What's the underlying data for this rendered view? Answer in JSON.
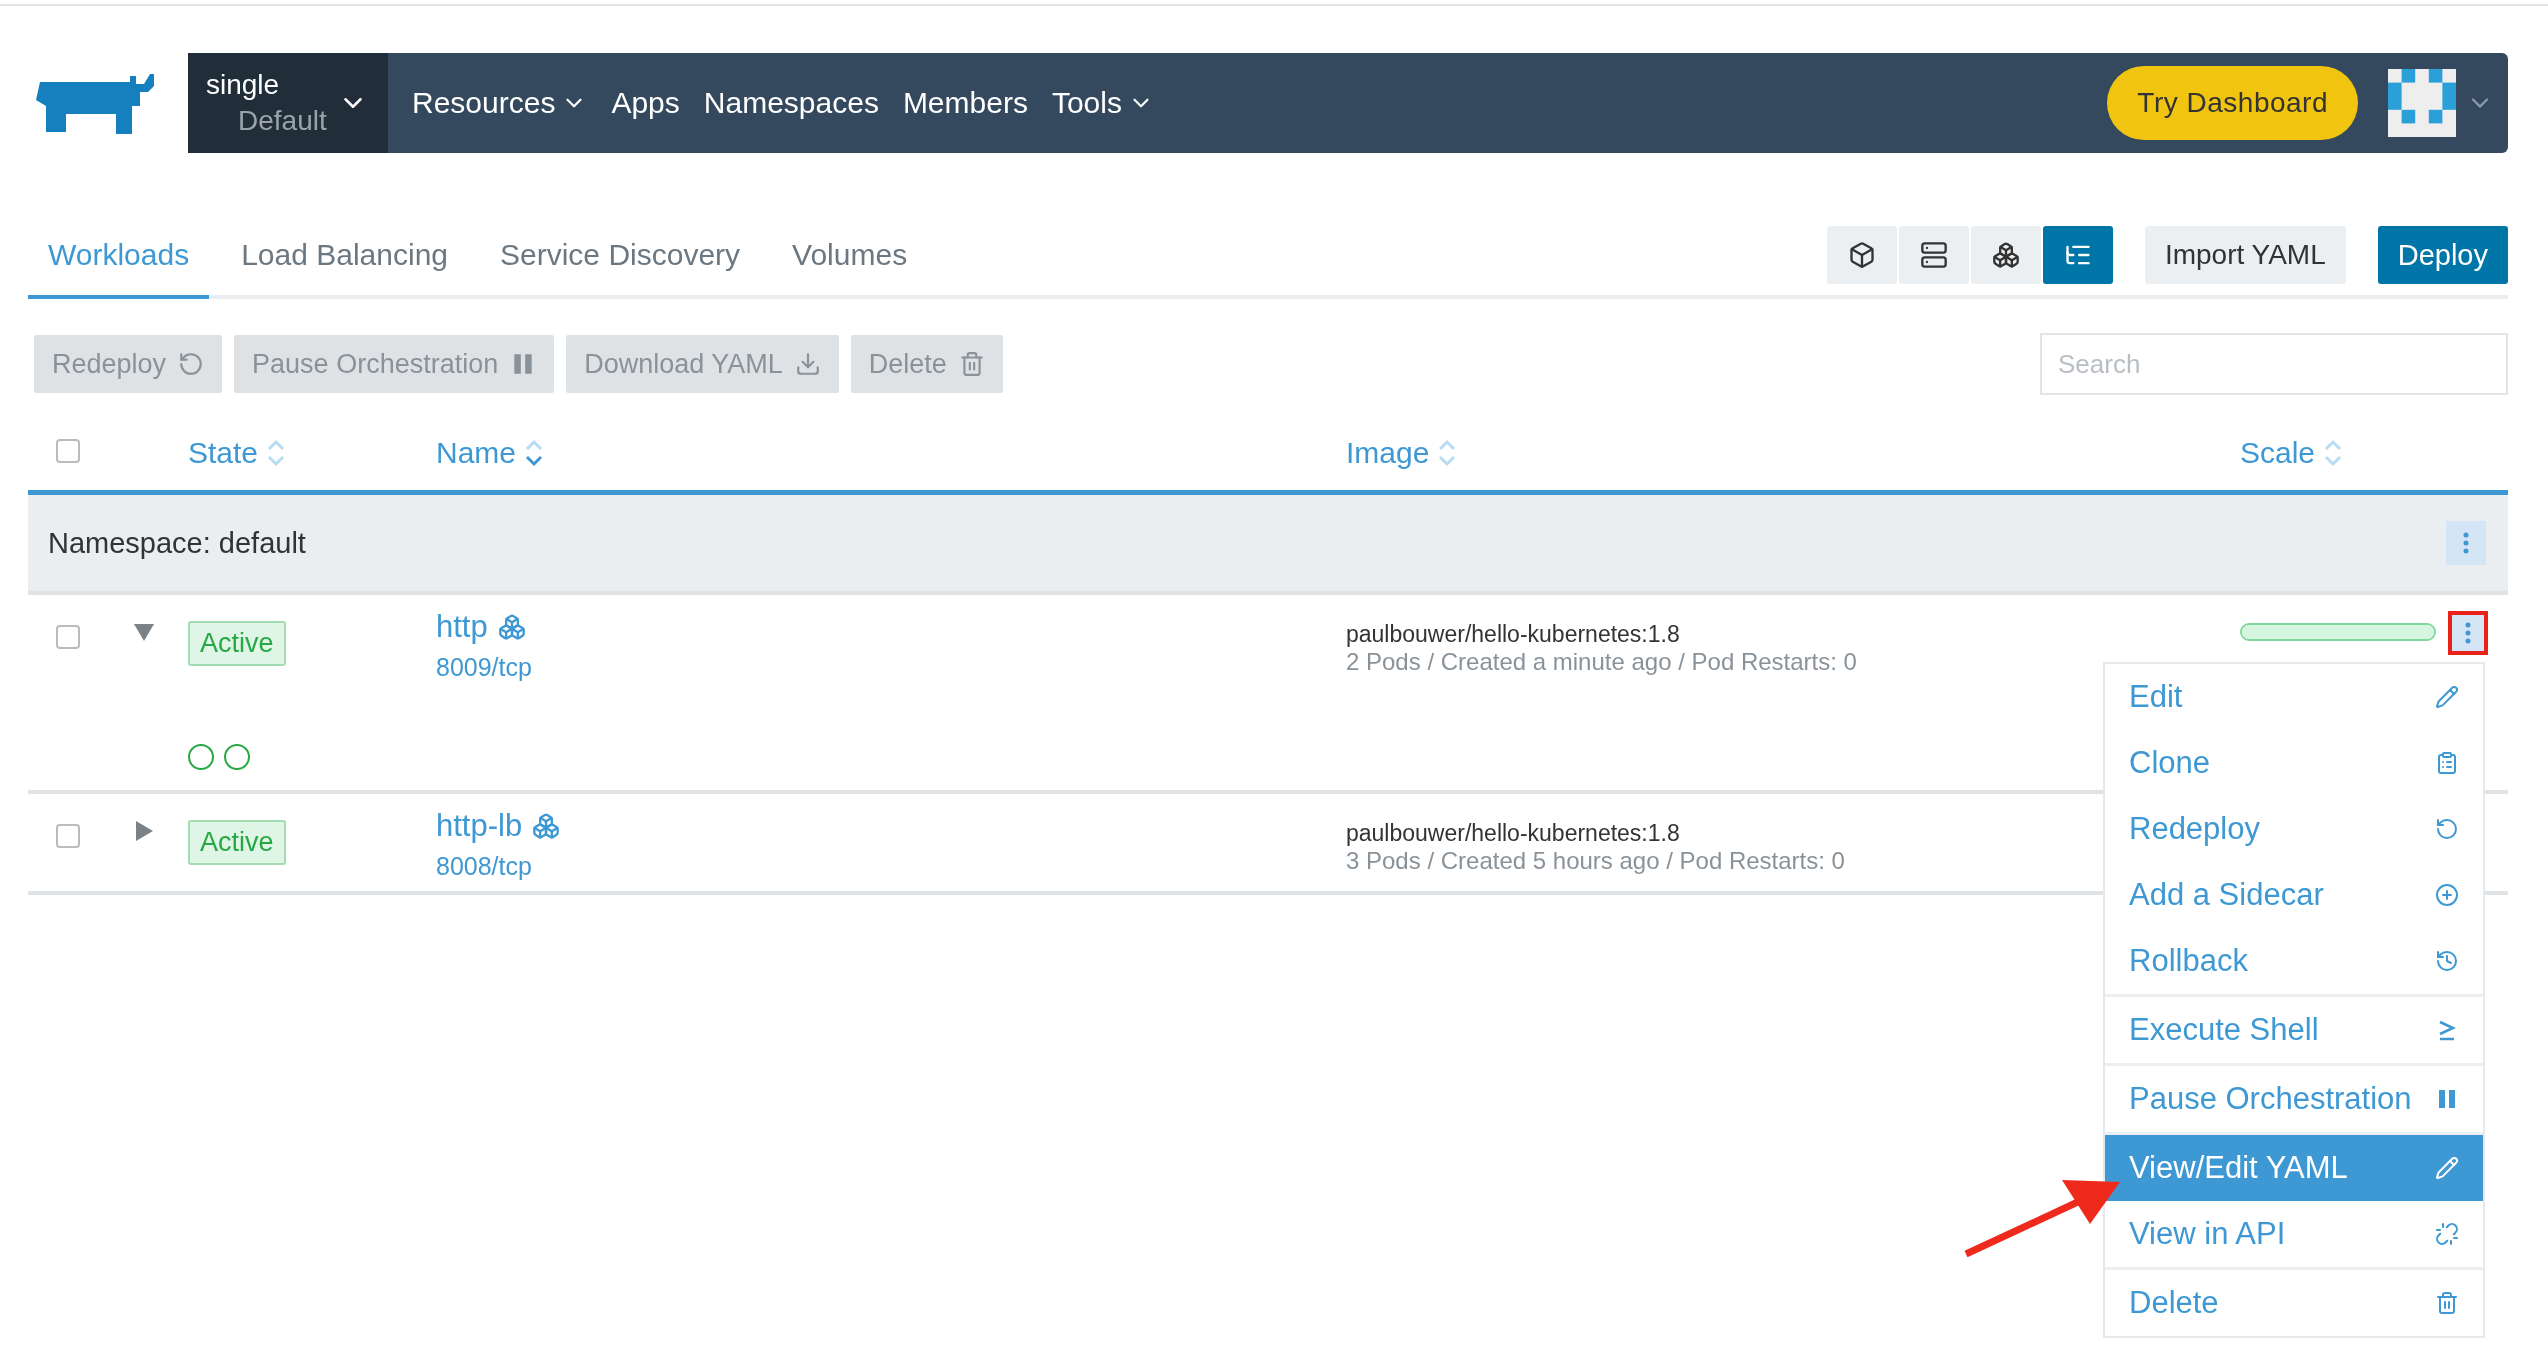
{
  "header": {
    "cluster": "single",
    "project": "Default",
    "nav": [
      {
        "label": "Resources",
        "dropdown": true
      },
      {
        "label": "Apps",
        "dropdown": false
      },
      {
        "label": "Namespaces",
        "dropdown": false
      },
      {
        "label": "Members",
        "dropdown": false
      },
      {
        "label": "Tools",
        "dropdown": true
      }
    ],
    "dashboard_button": "Try Dashboard"
  },
  "tabs": [
    {
      "label": "Workloads",
      "selected": true
    },
    {
      "label": "Load Balancing",
      "selected": false
    },
    {
      "label": "Service Discovery",
      "selected": false
    },
    {
      "label": "Volumes",
      "selected": false
    }
  ],
  "view_buttons": [
    {
      "kind": "box",
      "selected": false
    },
    {
      "kind": "server",
      "selected": false
    },
    {
      "kind": "boxes",
      "selected": false
    },
    {
      "kind": "list",
      "selected": true
    }
  ],
  "import_button": "Import YAML",
  "deploy_button": "Deploy",
  "actions": [
    {
      "label": "Redeploy",
      "kind": "redeploy"
    },
    {
      "label": "Pause Orchestration",
      "kind": "pause"
    },
    {
      "label": "Download YAML",
      "kind": "download"
    },
    {
      "label": "Delete",
      "kind": "delete"
    }
  ],
  "search": {
    "placeholder": "Search"
  },
  "table": {
    "select_all": {
      "checked": false
    },
    "columns": [
      {
        "label": "State",
        "sorted": false
      },
      {
        "label": "Name",
        "sorted": true
      },
      {
        "label": "Image",
        "sorted": false
      },
      {
        "label": "Scale",
        "sorted": false
      }
    ],
    "group": {
      "label": "Namespace: default"
    },
    "rows": [
      {
        "checked": false,
        "expanded": true,
        "state": "Active",
        "name": "http",
        "port": "8009/tcp",
        "image": "paulbouwer/hello-kubernetes:1.8",
        "details": "2 Pods / Created a minute ago / Pod Restarts: 0",
        "scale": {
          "level": 1
        },
        "menu_open": true,
        "pods": [
          {
            "kind": "running"
          },
          {
            "kind": "running"
          }
        ]
      },
      {
        "checked": false,
        "expanded": false,
        "state": "Active",
        "name": "http-lb",
        "port": "8008/tcp",
        "image": "paulbouwer/hello-kubernetes:1.8",
        "details": "3 Pods / Created 5 hours ago / Pod Restarts: 0",
        "menu_open": false
      }
    ]
  },
  "menu": [
    [
      {
        "label": "Edit",
        "kind": "edit",
        "selected": false
      },
      {
        "label": "Clone",
        "kind": "clone",
        "selected": false
      },
      {
        "label": "Redeploy",
        "kind": "redeploy",
        "selected": false
      },
      {
        "label": "Add a Sidecar",
        "kind": "add",
        "selected": false
      },
      {
        "label": "Rollback",
        "kind": "rollback",
        "selected": false
      }
    ],
    [
      {
        "label": "Execute Shell",
        "kind": "shell",
        "selected": false
      }
    ],
    [
      {
        "label": "Pause Orchestration",
        "kind": "pause",
        "selected": false
      }
    ],
    [
      {
        "label": "View/Edit YAML",
        "kind": "edit",
        "selected": true
      },
      {
        "label": "View in API",
        "kind": "api",
        "selected": false
      }
    ],
    [
      {
        "label": "Delete",
        "kind": "delete",
        "selected": false
      }
    ]
  ]
}
